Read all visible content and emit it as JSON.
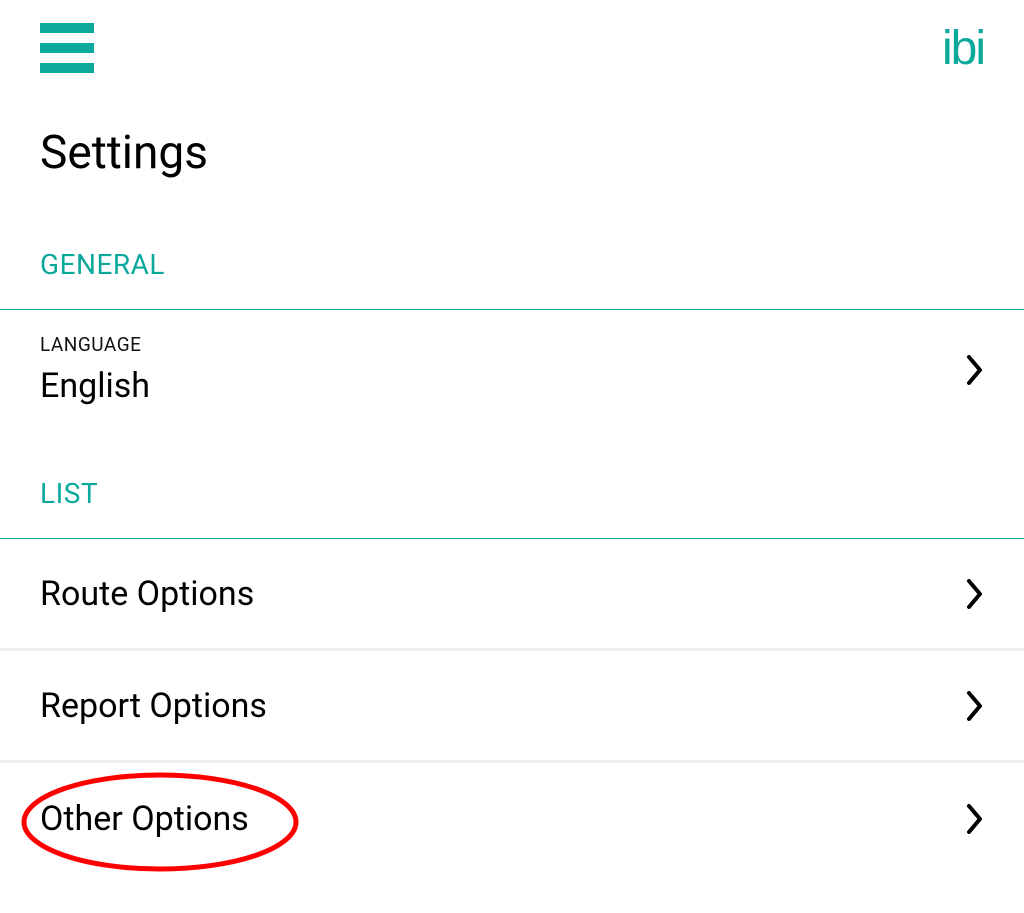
{
  "brand": {
    "logo_text": "ibi"
  },
  "page": {
    "title": "Settings"
  },
  "sections": {
    "general": {
      "header": "GENERAL",
      "language": {
        "label": "LANGUAGE",
        "value": "English"
      }
    },
    "list": {
      "header": "LIST",
      "items": [
        {
          "label": "Route Options"
        },
        {
          "label": "Report Options"
        },
        {
          "label": "Other Options"
        }
      ]
    }
  }
}
